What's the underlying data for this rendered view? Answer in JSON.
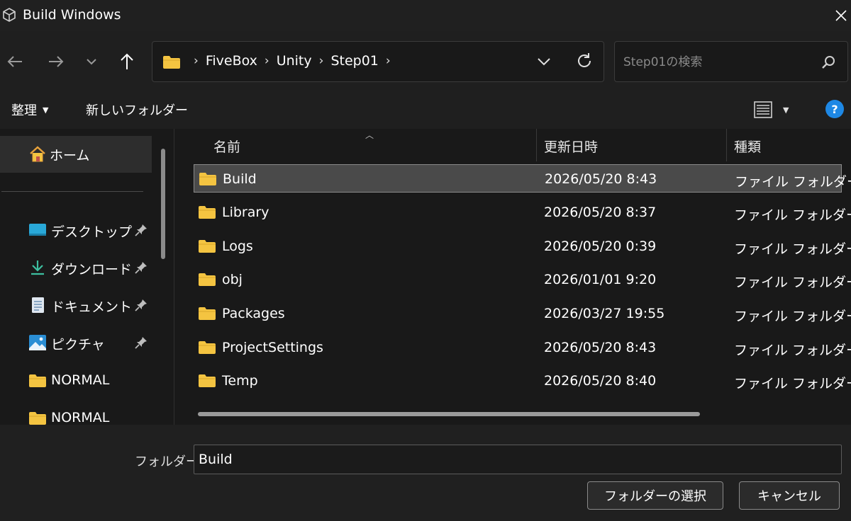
{
  "window": {
    "title": "Build Windows",
    "app_icon": "unity-cube-icon"
  },
  "nav": {
    "back_icon": "arrow-left-icon",
    "forward_icon": "arrow-right-icon",
    "recent_icon": "chevron-down-icon",
    "up_icon": "arrow-up-icon",
    "breadcrumbs": [
      "FiveBox",
      "Unity",
      "Step01"
    ],
    "search_placeholder": "Step01の検索"
  },
  "toolbar": {
    "organize_label": "整理",
    "new_folder_label": "新しいフォルダー"
  },
  "sidebar": {
    "home_label": "ホーム",
    "items": [
      {
        "label": "デスクトップ",
        "icon": "desktop-icon",
        "pinned": true
      },
      {
        "label": "ダウンロード",
        "icon": "download-icon",
        "pinned": true
      },
      {
        "label": "ドキュメント",
        "icon": "document-icon",
        "pinned": true
      },
      {
        "label": "ピクチャ",
        "icon": "pictures-icon",
        "pinned": true
      },
      {
        "label": "NORMAL",
        "icon": "folder-icon",
        "pinned": false
      },
      {
        "label": "NORMAL",
        "icon": "folder-icon",
        "pinned": false
      }
    ]
  },
  "columns": {
    "name": "名前",
    "modified": "更新日時",
    "type": "種類"
  },
  "files": [
    {
      "name": "Build",
      "modified": "2026/05/20 8:43",
      "type": "ファイル フォルダー",
      "selected": true
    },
    {
      "name": "Library",
      "modified": "2026/05/20 8:37",
      "type": "ファイル フォルダー",
      "selected": false
    },
    {
      "name": "Logs",
      "modified": "2026/05/20 0:39",
      "type": "ファイル フォルダー",
      "selected": false
    },
    {
      "name": "obj",
      "modified": "2026/01/01 9:20",
      "type": "ファイル フォルダー",
      "selected": false
    },
    {
      "name": "Packages",
      "modified": "2026/03/27 19:55",
      "type": "ファイル フォルダー",
      "selected": false
    },
    {
      "name": "ProjectSettings",
      "modified": "2026/05/20 8:43",
      "type": "ファイル フォルダー",
      "selected": false
    },
    {
      "name": "Temp",
      "modified": "2026/05/20 8:40",
      "type": "ファイル フォルダー",
      "selected": false
    }
  ],
  "footer": {
    "folder_label": "フォルダー:",
    "folder_value": "Build",
    "select_button": "フォルダーの選択",
    "cancel_button": "キャンセル"
  },
  "colors": {
    "folder": "#f4c441",
    "accent": "#1e88e5",
    "selected_row": "#4a4a4a"
  }
}
